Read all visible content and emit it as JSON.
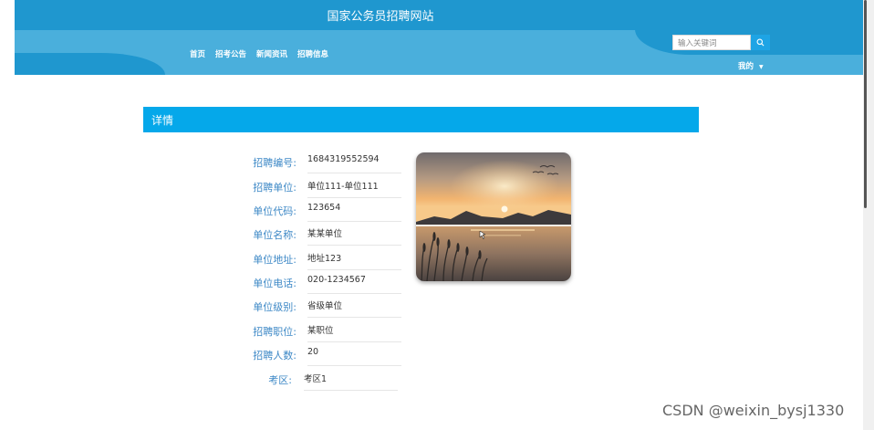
{
  "header": {
    "site_title": "国家公务员招聘网站",
    "nav": [
      {
        "label": "首页"
      },
      {
        "label": "招考公告"
      },
      {
        "label": "新闻资讯"
      },
      {
        "label": "招聘信息"
      }
    ],
    "search": {
      "placeholder": "输入关键词",
      "icon": "search-icon"
    },
    "user_menu": {
      "label": "我的",
      "icon": "caret-down-icon"
    }
  },
  "panel": {
    "title": "详情"
  },
  "details": [
    {
      "label": "招聘编号:",
      "value": "1684319552594"
    },
    {
      "label": "招聘单位:",
      "value": "单位111-单位111"
    },
    {
      "label": "单位代码:",
      "value": "123654"
    },
    {
      "label": "单位名称:",
      "value": "某某单位"
    },
    {
      "label": "单位地址:",
      "value": "地址123"
    },
    {
      "label": "单位电话:",
      "value": "020-1234567"
    },
    {
      "label": "单位级别:",
      "value": "省级单位"
    },
    {
      "label": "招聘职位:",
      "value": "某职位"
    },
    {
      "label": "招聘人数:",
      "value": "20"
    },
    {
      "label": "考区:",
      "value": "考区1"
    }
  ],
  "image": {
    "description_icon": "sunset-lake-image"
  },
  "watermark": "CSDN @weixin_bysj1330",
  "colors": {
    "header": "#1f97cf",
    "header_light": "#4aafdc",
    "panel": "#05a8ea",
    "label": "#3d88c6"
  }
}
